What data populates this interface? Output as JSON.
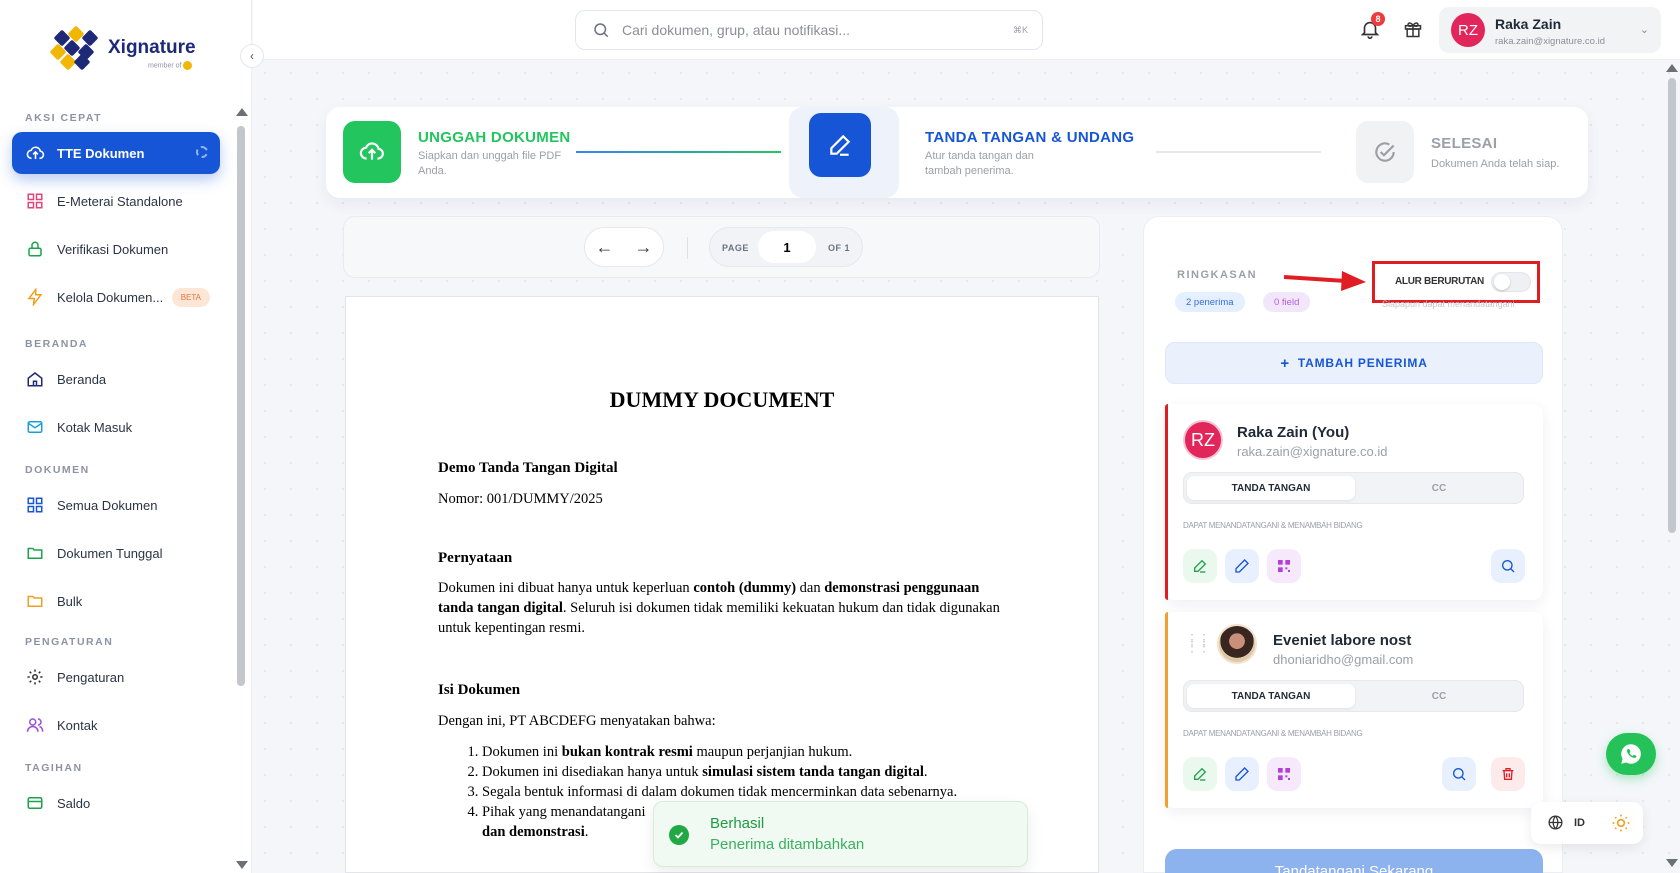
{
  "brand": {
    "name": "Xignature",
    "tagline": "member of"
  },
  "search": {
    "placeholder": "Cari dokumen, grup, atau notifikasi...",
    "shortcut": "⌘K"
  },
  "header": {
    "notifications_count": "8",
    "user": {
      "initials": "RZ",
      "name": "Raka Zain",
      "email": "raka.zain@xignature.co.id"
    }
  },
  "sidebar": {
    "sections": [
      {
        "title": "AKSI CEPAT",
        "items": [
          {
            "label": "TTE Dokumen",
            "icon": "upload-cloud-icon",
            "active": true
          },
          {
            "label": "E-Meterai Standalone",
            "icon": "grid-icon"
          },
          {
            "label": "Verifikasi Dokumen",
            "icon": "lock-icon"
          },
          {
            "label": "Kelola Dokumen...",
            "icon": "bolt-icon",
            "badge": "BETA"
          }
        ]
      },
      {
        "title": "BERANDA",
        "items": [
          {
            "label": "Beranda",
            "icon": "home-icon"
          },
          {
            "label": "Kotak Masuk",
            "icon": "mail-icon"
          }
        ]
      },
      {
        "title": "DOKUMEN",
        "items": [
          {
            "label": "Semua Dokumen",
            "icon": "grid-blue-icon"
          },
          {
            "label": "Dokumen Tunggal",
            "icon": "folder-green-icon"
          },
          {
            "label": "Bulk",
            "icon": "folder-yellow-icon"
          }
        ]
      },
      {
        "title": "PENGATURAN",
        "items": [
          {
            "label": "Pengaturan",
            "icon": "gear-icon"
          },
          {
            "label": "Kontak",
            "icon": "users-icon"
          }
        ]
      },
      {
        "title": "TAGIHAN",
        "items": [
          {
            "label": "Saldo",
            "icon": "card-icon"
          }
        ]
      }
    ]
  },
  "stepper": {
    "steps": [
      {
        "title": "UNGGAH DOKUMEN",
        "desc": "Siapkan dan unggah file PDF Anda.",
        "state": "done",
        "color": "#22c55e"
      },
      {
        "title": "TANDA TANGAN & UNDANG",
        "desc": "Atur tanda tangan dan tambah penerima.",
        "state": "active",
        "color": "#1656d6"
      },
      {
        "title": "SELESAI",
        "desc": "Dokumen Anda telah siap.",
        "state": "pending",
        "color": "#9aa0a8"
      }
    ]
  },
  "pager": {
    "page_label": "PAGE",
    "current_page": "1",
    "of_label": "OF 1"
  },
  "document": {
    "title": "DUMMY DOCUMENT",
    "subtitle": "Demo Tanda Tangan Digital",
    "number": "Nomor: 001/DUMMY/2025",
    "statement_heading": "Pernyataan",
    "statement": {
      "t1": "Dokumen ini dibuat hanya untuk keperluan ",
      "b1": "contoh (dummy)",
      "t2": " dan ",
      "b2": "demonstrasi penggunaan tanda tangan digital",
      "t3": ". Seluruh isi dokumen tidak memiliki kekuatan hukum dan tidak digunakan untuk kepentingan resmi."
    },
    "content_heading": "Isi Dokumen",
    "content_intro": "Dengan ini, PT ABCDEFG menyatakan bahwa:",
    "list": [
      {
        "t1": "Dokumen ini ",
        "b": "bukan kontrak resmi",
        "t2": " maupun perjanjian hukum."
      },
      {
        "t1": "Dokumen ini disediakan hanya untuk ",
        "b": "simulasi sistem tanda tangan digital",
        "t2": "."
      },
      {
        "t1": "Segala bentuk informasi di dalam dokumen tidak mencerminkan data sebenarnya.",
        "b": "",
        "t2": ""
      },
      {
        "t1": "Pihak yang menandatangani ",
        "b": "",
        "t2": "",
        "b2": "dan demonstrasi",
        "t3": "."
      }
    ]
  },
  "panel": {
    "summary_label": "RINGKASAN",
    "recipients_pill": "2 penerima",
    "fields_pill": "0 field",
    "sequential_label": "ALUR BERURUTAN",
    "sequential_enabled": false,
    "sequential_hint": "Siapapun dapat menandatangani",
    "add_recipient": "TAMBAH PENERIMA",
    "recipients": [
      {
        "initials": "RZ",
        "name": "Raka Zain (You)",
        "email": "raka.zain@xignature.co.id",
        "role_sign": "TANDA TANGAN",
        "role_cc": "CC",
        "permission": "DAPAT MENANDATANGANI & MENAMBAH BIDANG",
        "accent": "#e11d24"
      },
      {
        "name": "Eveniet labore nost",
        "email": "dhoniaridho@gmail.com",
        "role_sign": "TANDA TANGAN",
        "role_cc": "CC",
        "permission": "DAPAT MENANDATANGANI & MENAMBAH BIDANG",
        "accent": "#f0a030"
      }
    ],
    "submit": "Tandatangani Sekarang"
  },
  "toast": {
    "title": "Berhasil",
    "message": "Penerima ditambahkan"
  },
  "footer": {
    "language": "ID"
  }
}
